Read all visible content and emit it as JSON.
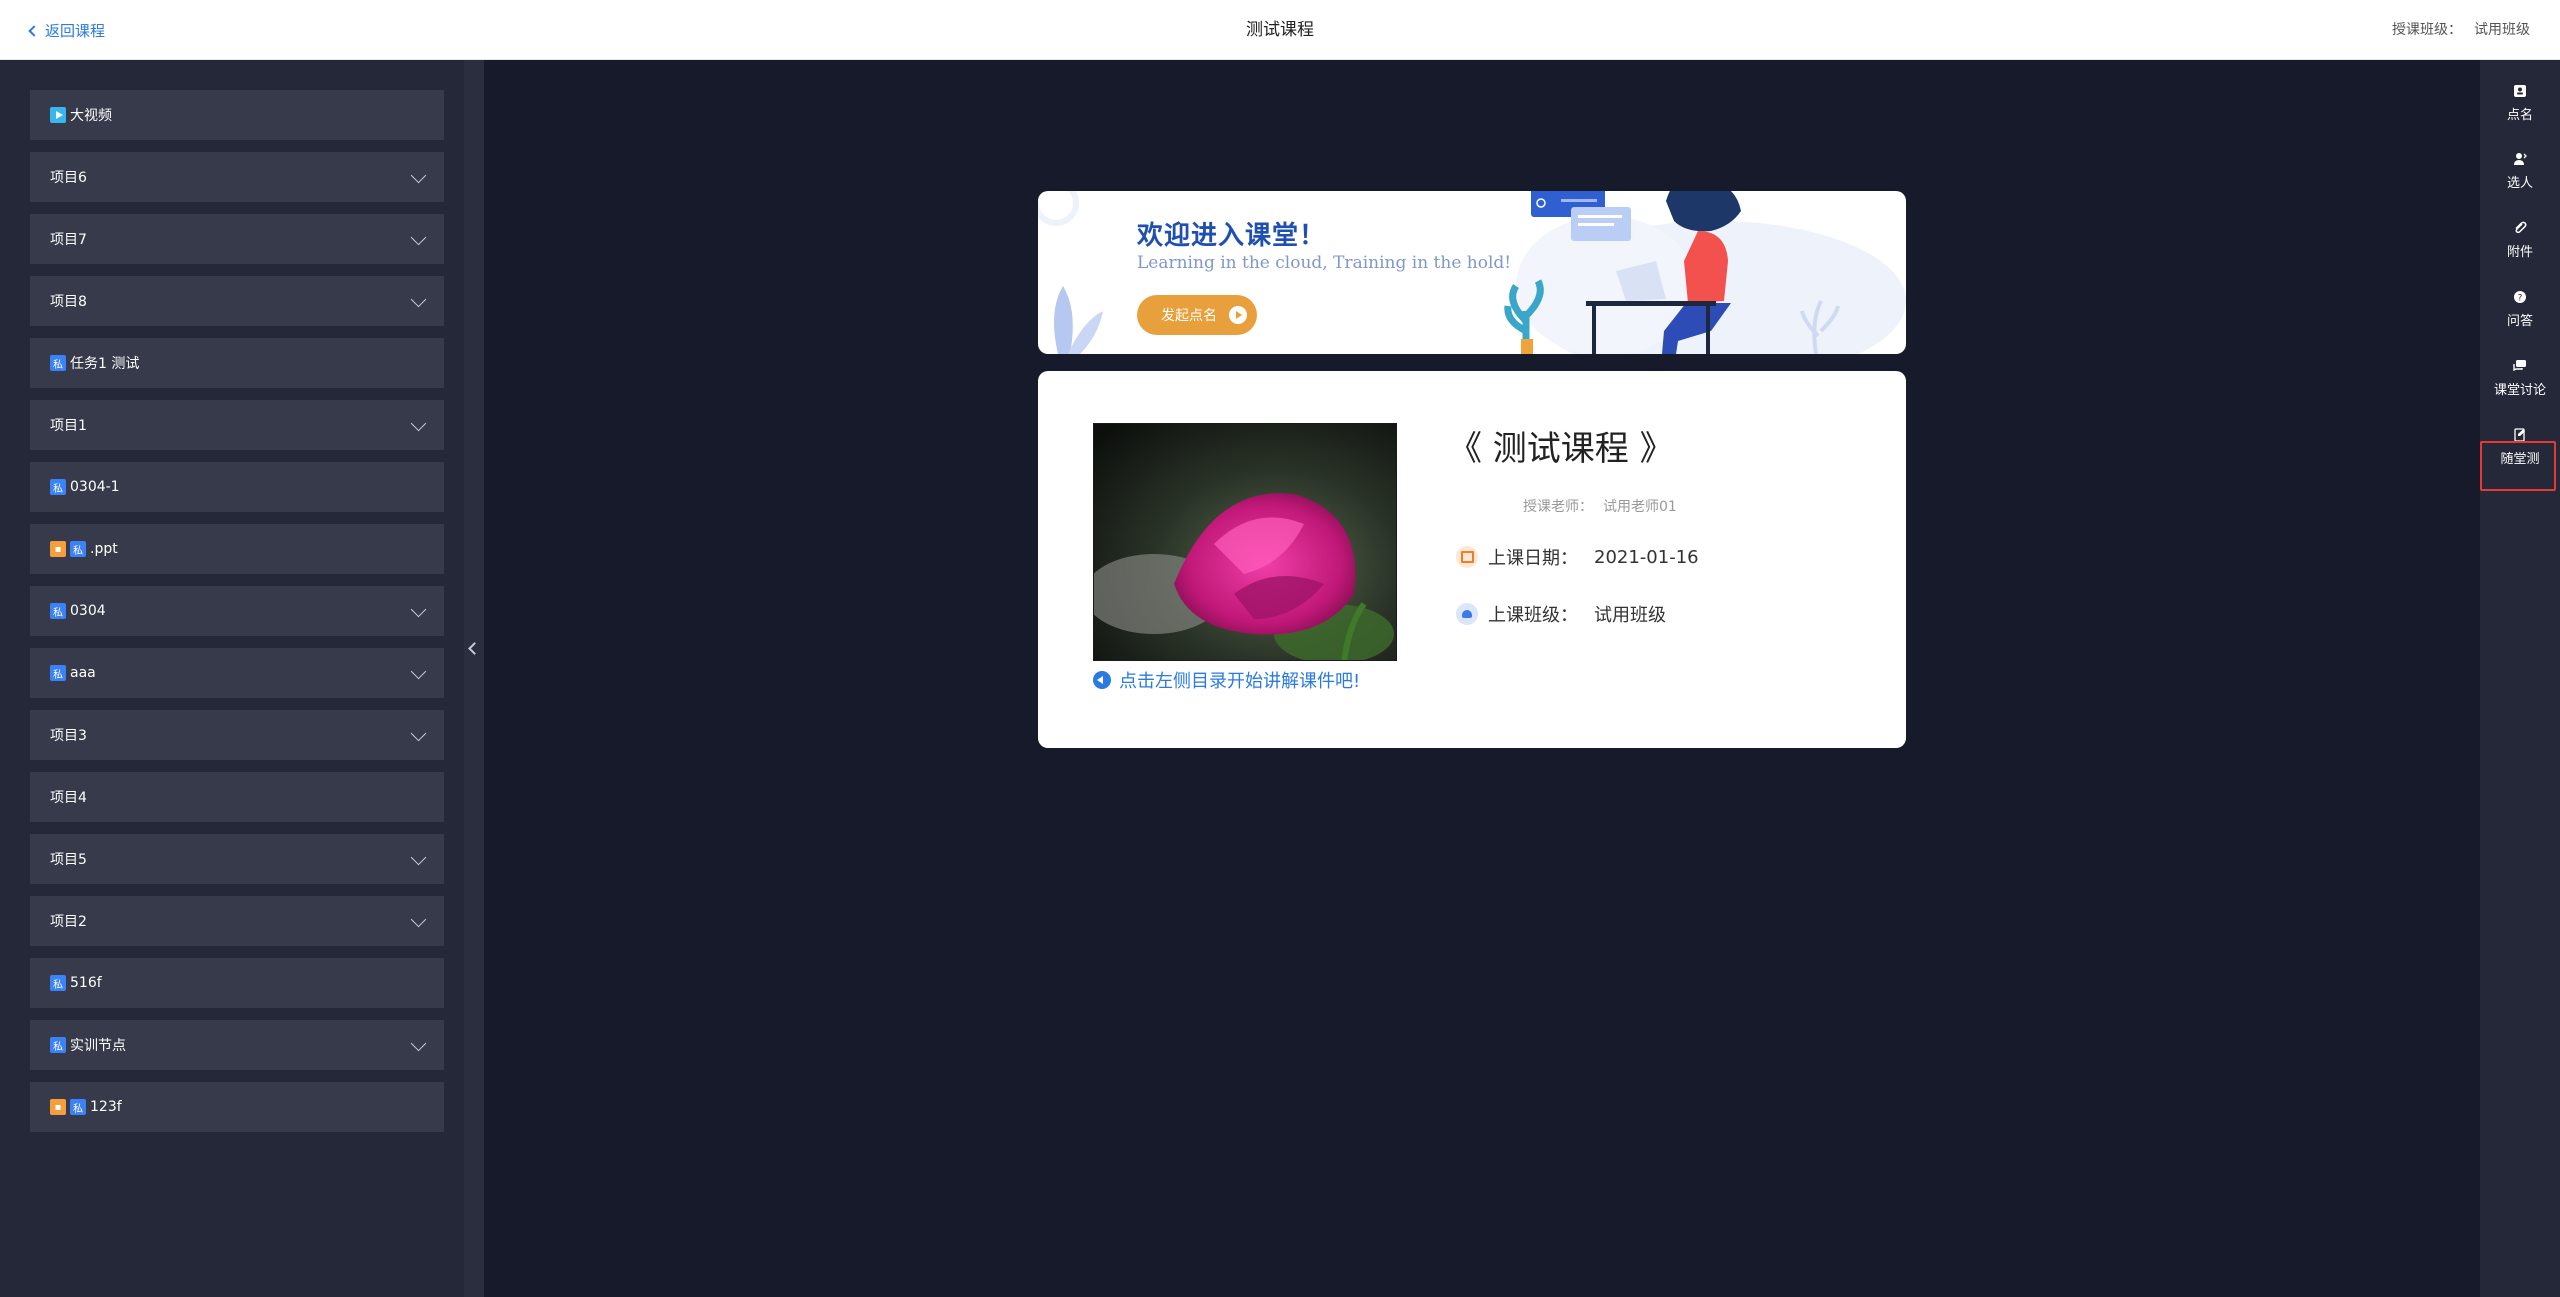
{
  "header": {
    "back_label": "返回课程",
    "title": "测试课程",
    "class_label": "授课班级：",
    "class_value": "试用班级"
  },
  "sidebar": {
    "items": [
      {
        "label": "大视频",
        "tag": "video",
        "expandable": false
      },
      {
        "label": "项目6",
        "tag": "",
        "expandable": true
      },
      {
        "label": "项目7",
        "tag": "",
        "expandable": true
      },
      {
        "label": "项目8",
        "tag": "",
        "expandable": true
      },
      {
        "label": "任务1 测试",
        "tag": "private",
        "expandable": false
      },
      {
        "label": "项目1",
        "tag": "",
        "expandable": true
      },
      {
        "label": "0304-1",
        "tag": "private",
        "expandable": false
      },
      {
        "label": ".ppt",
        "tag": "ppt-private",
        "expandable": false
      },
      {
        "label": "0304",
        "tag": "private",
        "expandable": true
      },
      {
        "label": "aaa",
        "tag": "private",
        "expandable": true
      },
      {
        "label": "项目3",
        "tag": "",
        "expandable": true
      },
      {
        "label": "项目4",
        "tag": "",
        "expandable": false
      },
      {
        "label": "项目5",
        "tag": "",
        "expandable": true
      },
      {
        "label": "项目2",
        "tag": "",
        "expandable": true
      },
      {
        "label": "516f",
        "tag": "private",
        "expandable": false
      },
      {
        "label": "实训节点",
        "tag": "private",
        "expandable": true
      },
      {
        "label": "123f",
        "tag": "ppt-private",
        "expandable": false
      }
    ],
    "private_tag": "私"
  },
  "right_rail": {
    "items": [
      {
        "label": "点名",
        "icon": "roll-call-icon"
      },
      {
        "label": "选人",
        "icon": "pick-person-icon"
      },
      {
        "label": "附件",
        "icon": "attachment-icon"
      },
      {
        "label": "问答",
        "icon": "question-icon"
      },
      {
        "label": "课堂讨论",
        "icon": "discussion-icon"
      },
      {
        "label": "随堂测",
        "icon": "quiz-icon"
      }
    ],
    "highlight_color": "#e53935"
  },
  "banner": {
    "title": "欢迎进入课堂！",
    "subtitle": "Learning in the cloud, Training in the hold!",
    "button_label": "发起点名"
  },
  "course": {
    "name": "《 测试课程 》",
    "teacher_label": "授课老师：",
    "teacher_value": "试用老师01",
    "date_label": "上课日期：",
    "date_value": "2021-01-16",
    "class_label": "上课班级：",
    "class_value": "试用班级",
    "hint": "点击左侧目录开始讲解课件吧!"
  },
  "colors": {
    "accent": "#2a7ae2",
    "banner_button": "#e8a03c",
    "sidebar_bg": "#242838",
    "stage_bg": "#171a2b"
  }
}
